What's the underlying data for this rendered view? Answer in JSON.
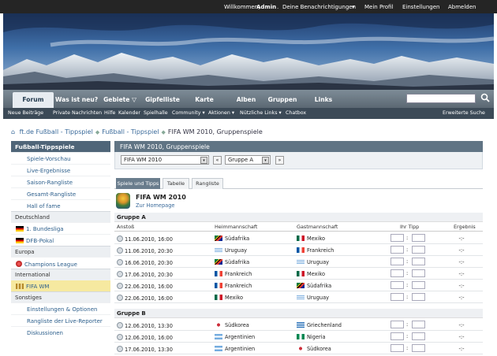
{
  "topbar": {
    "greeting": "Willkommen,",
    "user": "Admin",
    "sep": ".",
    "notifications": "Deine Benachrichtigungen",
    "notifications_caret": "▾",
    "profile": "Mein Profil",
    "settings": "Einstellungen",
    "logout": "Abmelden"
  },
  "nav": {
    "tabs": [
      "Forum",
      "Was ist neu?",
      "Gebiete ▽",
      "Gipfelliste",
      "Karte",
      "Alben",
      "Gruppen",
      "Links"
    ],
    "search_icon": "search-icon",
    "search_glyph": "⚲"
  },
  "subnav": {
    "items": [
      "Neue Beiträge",
      "Private Nachrichten",
      "Hilfe",
      "Kalender",
      "Spielhalle",
      "Community ▾",
      "Aktionen ▾",
      "Nützliche Links ▾",
      "Chatbox"
    ],
    "advanced_search": "Erweiterte Suche"
  },
  "breadcrumb": {
    "home_glyph": "⌂",
    "items": [
      "ft.de Fußball - Tippspiel",
      "Fußball - Tippspiel",
      "FIFA WM 2010, Gruppenspiele"
    ],
    "sep": "◆"
  },
  "sidebar": {
    "header": "Fußball-Tippspiele",
    "items1": [
      "Spiele-Vorschau",
      "Live-Ergebnisse",
      "Saison-Rangliste",
      "Gesamt-Rangliste",
      "Hall of fame"
    ],
    "sec_de": "Deutschland",
    "de_items": [
      "1. Bundesliga",
      "DFB-Pokal"
    ],
    "sec_eu": "Europa",
    "eu_items": [
      "Champions League"
    ],
    "sec_int": "International",
    "int_items": [
      "FIFA WM"
    ],
    "sec_misc": "Sonstiges",
    "misc_items": [
      "Einstellungen & Optionen",
      "Rangliste der Live-Reporter",
      "Diskussionen"
    ]
  },
  "main": {
    "header": "FIFA WM 2010, Gruppenspiele",
    "select_tournament": "FIFA WM 2010",
    "select_group": "Gruppe A",
    "prev": "«",
    "next": "»",
    "dd": "▾",
    "tabs": [
      "Spiele und Tipps",
      "Tabelle",
      "Rangliste"
    ],
    "event_title": "FIFA WM 2010",
    "homepage_link": "Zur Homepage",
    "columns": {
      "kickoff": "Anstoß",
      "home": "Heimmannschaft",
      "away": "Gastmannschaft",
      "tip": "Ihr Tipp",
      "result": "Ergebnis"
    },
    "groupA": "Gruppe A",
    "groupB": "Gruppe B",
    "colon": ":",
    "matchesA": [
      {
        "date": "11.06.2010, 16:00",
        "home": "Südafrika",
        "away": "Mexiko",
        "result": "-:-"
      },
      {
        "date": "11.06.2010, 20:30",
        "home": "Uruguay",
        "away": "Frankreich",
        "result": "-:-"
      },
      {
        "date": "16.06.2010, 20:30",
        "home": "Südafrika",
        "away": "Uruguay",
        "result": "-:-"
      },
      {
        "date": "17.06.2010, 20:30",
        "home": "Frankreich",
        "away": "Mexiko",
        "result": "-:-"
      },
      {
        "date": "22.06.2010, 16:00",
        "home": "Frankreich",
        "away": "Südafrika",
        "result": "-:-"
      },
      {
        "date": "22.06.2010, 16:00",
        "home": "Mexiko",
        "away": "Uruguay",
        "result": "-:-"
      }
    ],
    "matchesB": [
      {
        "date": "12.06.2010, 13:30",
        "home": "Südkorea",
        "away": "Griechenland",
        "result": "-:-"
      },
      {
        "date": "12.06.2010, 16:00",
        "home": "Argentinien",
        "away": "Nigeria",
        "result": "-:-"
      },
      {
        "date": "17.06.2010, 13:30",
        "home": "Argentinien",
        "away": "Südkorea",
        "result": "-:-"
      }
    ]
  },
  "colors": {
    "topbar": "#252525",
    "nav": "#5b6873",
    "subnav": "#3c4a57",
    "sidebar_header": "#4f6578",
    "selected_item": "#f6e9a0",
    "link": "#2d5f8c"
  }
}
